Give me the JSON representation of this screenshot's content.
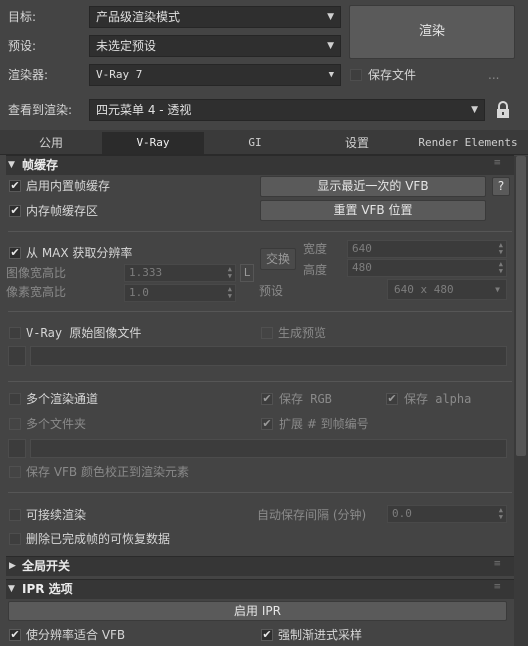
{
  "top": {
    "target_label": "目标:",
    "target_value": "产品级渲染模式",
    "preset_label": "预设:",
    "preset_value": "未选定预设",
    "renderer_label": "渲染器:",
    "renderer_value": "V-Ray 7",
    "save_file_label": "保存文件",
    "more_label": "...",
    "view_label": "查看到渲染:",
    "view_value": "四元菜单 4 - 透视",
    "render_button": "渲染"
  },
  "tabs": [
    "公用",
    "V-Ray",
    "GI",
    "设置",
    "Render Elements"
  ],
  "frame_buffer": {
    "title": "帧缓存",
    "enable_builtin": "启用内置帧缓存",
    "memory_fb": "内存帧缓存区",
    "show_last_vfb": "显示最近一次的 VFB",
    "help": "?",
    "reset_vfb_pos": "重置 VFB 位置",
    "get_res_from_max": "从 MAX 获取分辨率",
    "swap": "交换",
    "width_label": "宽度",
    "width_value": "640",
    "height_label": "高度",
    "height_value": "480",
    "image_aspect_label": "图像宽高比",
    "image_aspect_value": "1.333",
    "lock_label": "L",
    "pixel_aspect_label": "像素宽高比",
    "pixel_aspect_value": "1.0",
    "preset_label": "预设",
    "preset_value": "640 x 480",
    "vray_raw_image": "V-Ray 原始图像文件",
    "generate_preview": "生成预览",
    "multiple_channels": "多个渲染通道",
    "save_rgb": "保存 RGB",
    "save_alpha": "保存 alpha",
    "multiple_files": "多个文件夹",
    "extend_frame": "扩展 # 到帧编号",
    "save_vfb_color": "保存 VFB 颜色校正到渲染元素",
    "resumable": "可接续渲染",
    "autosave_label": "自动保存间隔 (分钟)",
    "autosave_value": "0.0",
    "delete_recovery": "删除已完成帧的可恢复数据"
  },
  "global_switches": {
    "title": "全局开关"
  },
  "ipr": {
    "title": "IPR 选项",
    "enable_ipr": "启用 IPR",
    "fit_res_vfb": "使分辨率适合 VFB",
    "force_progressive": "强制渐进式采样"
  },
  "icons": {
    "lock": "lock-icon",
    "collapse": "triangle-down-icon",
    "expand": "triangle-right-icon",
    "grip": "grip-icon"
  }
}
